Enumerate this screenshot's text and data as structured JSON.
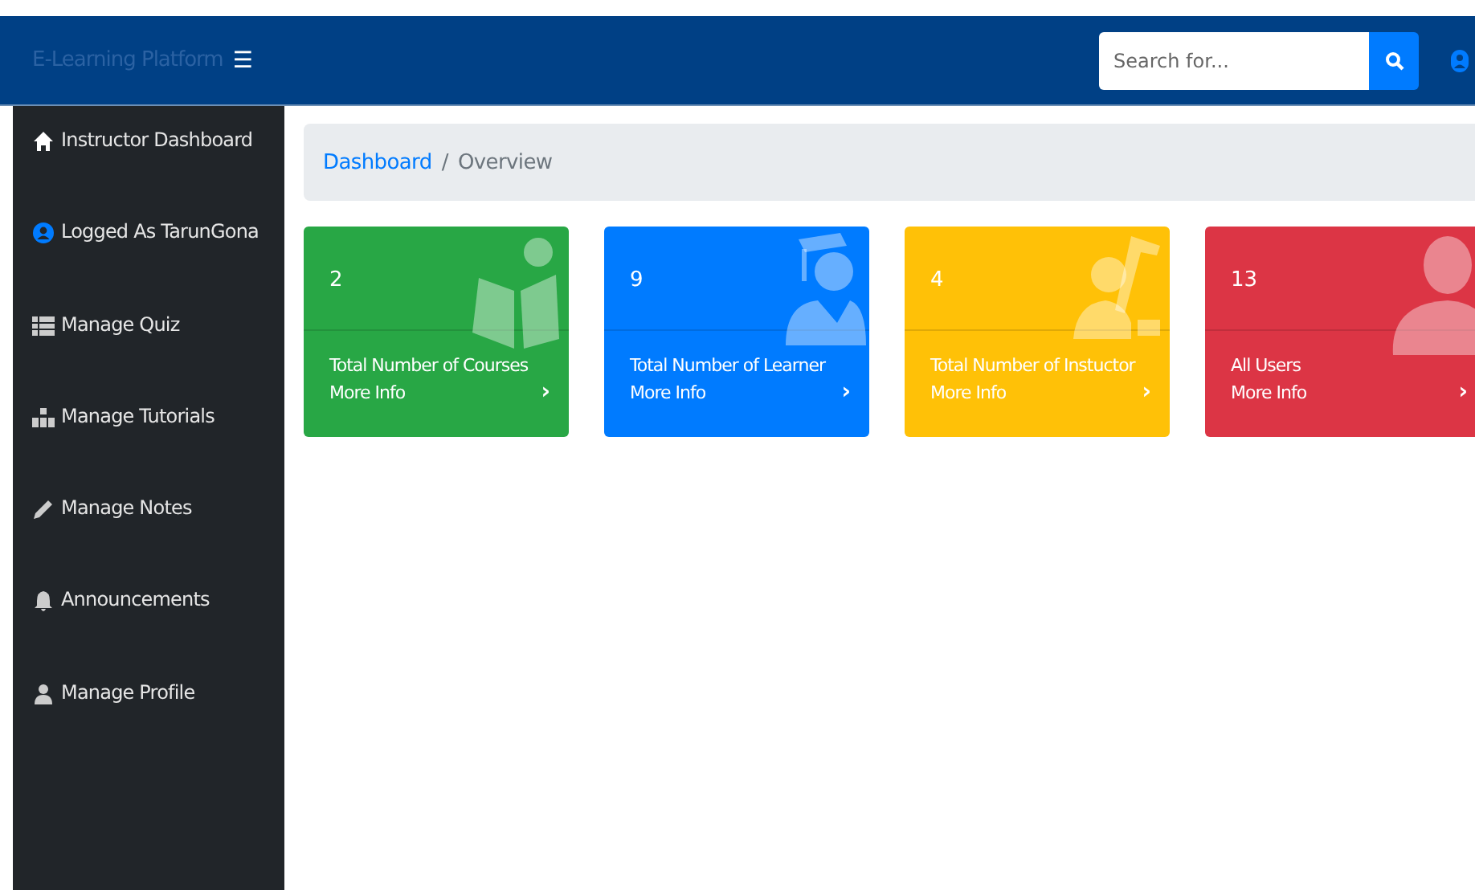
{
  "navbar": {
    "brand": "E-Learning Platform",
    "menu_glyph": "☰",
    "search": {
      "placeholder": "Search for..."
    }
  },
  "sidebar": {
    "items": [
      {
        "label": "Instructor Dashboard",
        "kind": "home"
      },
      {
        "label": "Logged As TarunGona",
        "kind": "account"
      },
      {
        "label": "Manage Quiz",
        "kind": "table"
      },
      {
        "label": "Manage Tutorials",
        "kind": "tree"
      },
      {
        "label": "Manage Notes",
        "kind": "pencil"
      },
      {
        "label": "Announcements",
        "kind": "bell"
      },
      {
        "label": "Manage Profile",
        "kind": "user"
      }
    ]
  },
  "breadcrumb": [
    {
      "label": "Dashboard",
      "kind": "link"
    },
    {
      "label": "/",
      "kind": "separator"
    },
    {
      "label": "Overview",
      "kind": "current"
    }
  ],
  "cards": [
    {
      "count": "2",
      "title": "Total Number of Courses",
      "link": "More Info",
      "arrow": "›",
      "color": "#28a745",
      "kind": "reader"
    },
    {
      "count": "9",
      "title": "Total Number of Learner",
      "link": "More Info",
      "arrow": "›",
      "color": "#007bff",
      "kind": "graduate"
    },
    {
      "count": "4",
      "title": "Total Number of Instuctor",
      "link": "More Info",
      "arrow": "›",
      "color": "#ffc107",
      "kind": "teacher"
    },
    {
      "count": "13",
      "title": "All Users",
      "link": "More Info",
      "arrow": "›",
      "color": "#dc3545",
      "kind": "user"
    }
  ]
}
